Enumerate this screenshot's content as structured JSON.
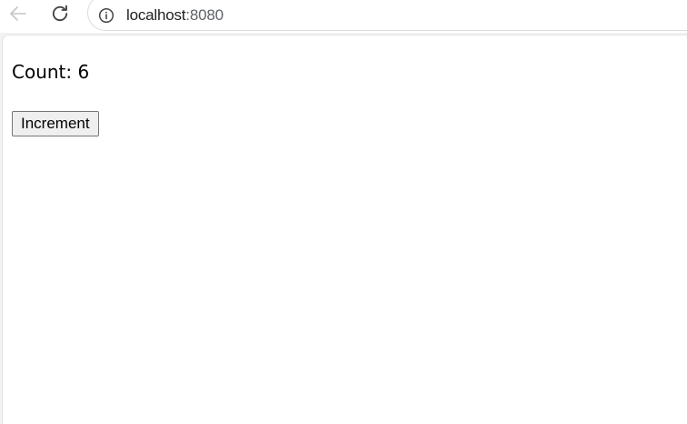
{
  "browser": {
    "url_host": "localhost",
    "url_port": ":8080",
    "icons": {
      "back": "arrow-left-icon",
      "reload": "reload-icon",
      "site_info": "info-circle-icon"
    }
  },
  "page": {
    "count_label": "Count: ",
    "count_value": "6",
    "increment_label": "Increment"
  }
}
